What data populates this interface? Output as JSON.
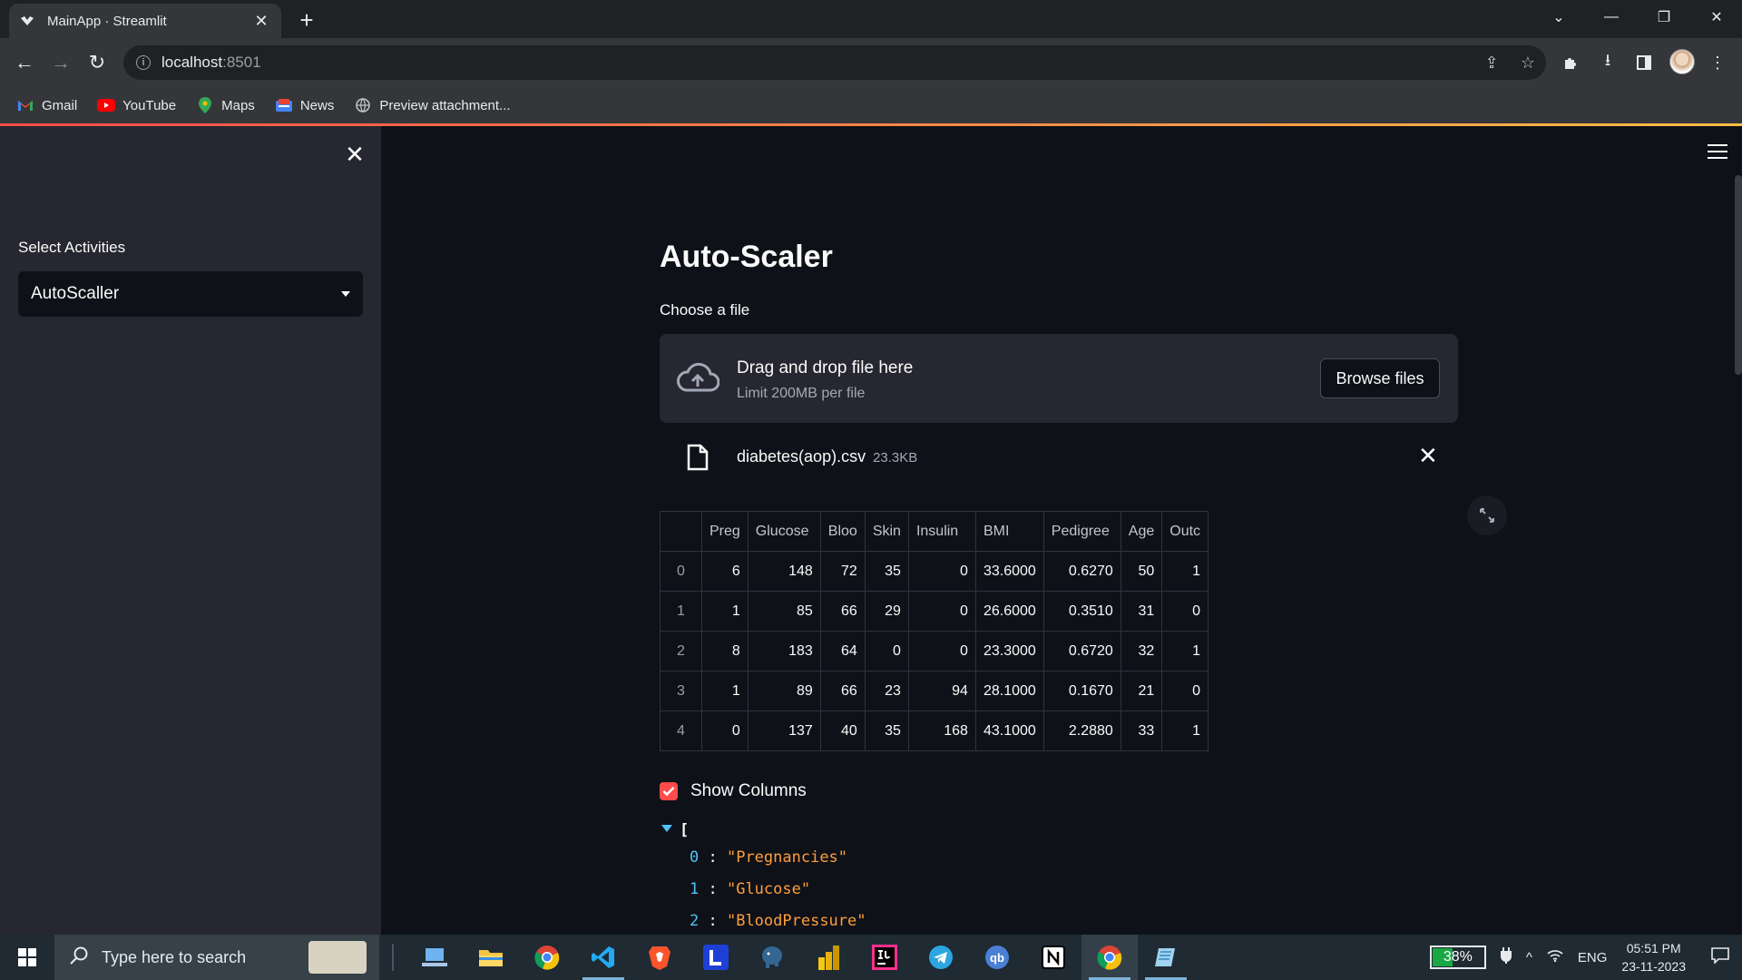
{
  "browser": {
    "tab_title": "MainApp · Streamlit",
    "new_tab": "+",
    "url_host": "localhost",
    "url_port": ":8501",
    "bookmarks": [
      {
        "label": "Gmail",
        "icon": "gmail-icon"
      },
      {
        "label": "YouTube",
        "icon": "youtube-icon"
      },
      {
        "label": "Maps",
        "icon": "maps-icon"
      },
      {
        "label": "News",
        "icon": "news-icon"
      },
      {
        "label": "Preview attachment...",
        "icon": "globe-icon"
      }
    ]
  },
  "sidebar": {
    "label": "Select Activities",
    "selected": "AutoScaller"
  },
  "main": {
    "title": "Auto-Scaler",
    "uploader_label": "Choose a file",
    "dropzone_title": "Drag and drop file here",
    "dropzone_limit": "Limit 200MB per file",
    "browse_button": "Browse files",
    "file_name": "diabetes(aop).csv",
    "file_size": "23.3KB",
    "checkbox_label": "Show Columns",
    "checkbox_checked": true
  },
  "table": {
    "headers": [
      "",
      "Preg",
      "Glucose",
      "Bloo",
      "Skin",
      "Insulin",
      "BMI",
      "Pedigree",
      "Age",
      "Outc"
    ],
    "rows": [
      [
        "0",
        "6",
        "148",
        "72",
        "35",
        "0",
        "33.6000",
        "0.6270",
        "50",
        "1"
      ],
      [
        "1",
        "1",
        "85",
        "66",
        "29",
        "0",
        "26.6000",
        "0.3510",
        "31",
        "0"
      ],
      [
        "2",
        "8",
        "183",
        "64",
        "0",
        "0",
        "23.3000",
        "0.6720",
        "32",
        "1"
      ],
      [
        "3",
        "1",
        "89",
        "66",
        "23",
        "94",
        "28.1000",
        "0.1670",
        "21",
        "0"
      ],
      [
        "4",
        "0",
        "137",
        "40",
        "35",
        "168",
        "43.1000",
        "2.2880",
        "33",
        "1"
      ]
    ]
  },
  "json_view": {
    "open_bracket": "[",
    "items": [
      {
        "index": "0",
        "value": "\"Pregnancies\""
      },
      {
        "index": "1",
        "value": "\"Glucose\""
      },
      {
        "index": "2",
        "value": "\"BloodPressure\""
      }
    ]
  },
  "taskbar": {
    "search_placeholder": "Type here to search",
    "battery": "38%",
    "battery_level": 0.38,
    "language": "ENG",
    "time": "05:51 PM",
    "date": "23-11-2023"
  },
  "colors": {
    "accent": "#ff4b4b",
    "background": "#0e1117",
    "sidebar": "#262730"
  }
}
